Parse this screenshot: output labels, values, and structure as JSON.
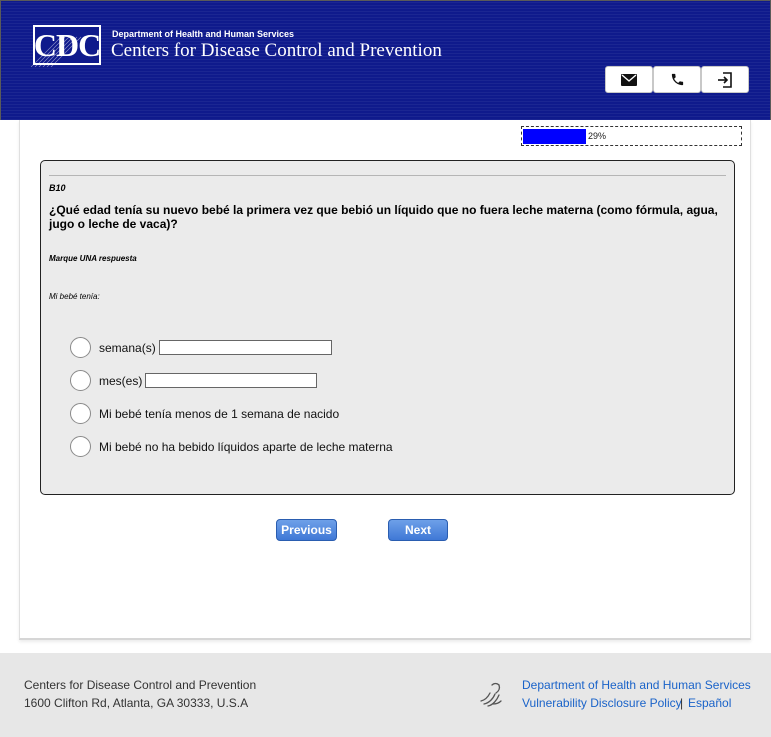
{
  "header": {
    "logo_text": "CDC",
    "department": "Department of Health and Human Services",
    "agency": "Centers for Disease Control and Prevention",
    "buttons": {
      "email_icon": "envelope-icon",
      "phone_icon": "phone-icon",
      "logout_icon": "sign-out-icon"
    },
    "color": "#0f1a8c"
  },
  "progress": {
    "percent_label": "29%",
    "fraction": 0.29,
    "color": "#0000ff"
  },
  "question": {
    "id": "B10",
    "text": "¿Qué edad tenía su nuevo bebé la primera vez que bebió un líquido que no fuera leche materna (como fórmula, agua, jugo o leche de vaca)?",
    "instruction": "Marque UNA respuesta",
    "lead_in": "Mi bebé tenía:",
    "options": [
      {
        "label": "semana(s)",
        "has_input": true,
        "value": ""
      },
      {
        "label": "mes(es)",
        "has_input": true,
        "value": ""
      },
      {
        "label": "Mi bebé tenía menos de 1 semana de nacido",
        "has_input": false
      },
      {
        "label": "Mi bebé no ha bebido líquidos aparte de leche materna",
        "has_input": false
      }
    ]
  },
  "nav": {
    "previous_label": "Previous",
    "next_label": "Next"
  },
  "footer": {
    "org": "Centers for Disease Control and Prevention",
    "address": "1600 Clifton Rd, Atlanta, GA 30333, U.S.A",
    "hhs_link": "Department of Health and Human Services",
    "vuln_link": "Vulnerability Disclosure Policy",
    "separator": "|",
    "spanish_link": "Español",
    "link_color": "#1a63c9"
  }
}
